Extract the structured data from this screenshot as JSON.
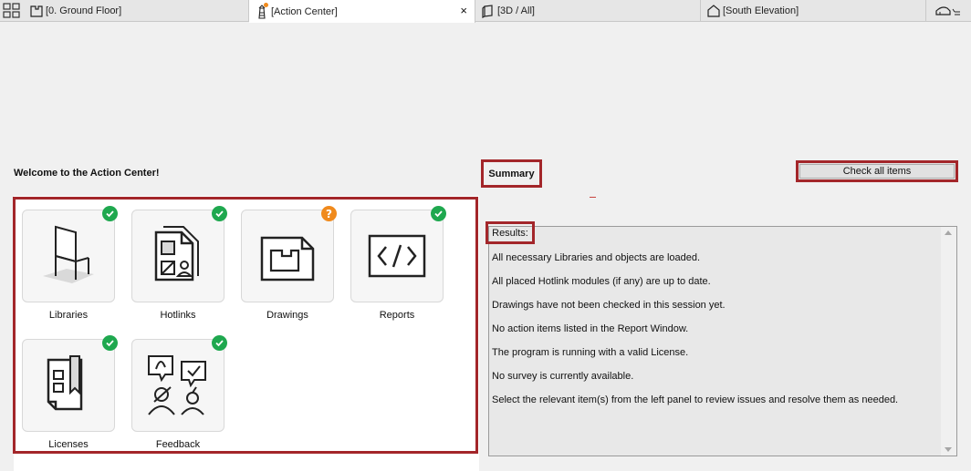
{
  "tabs": [
    {
      "label": "[0. Ground Floor]",
      "icon": "floor-plan-icon"
    },
    {
      "label": "[Action Center]",
      "icon": "lighthouse-icon",
      "active": true,
      "close": "×"
    },
    {
      "label": "[3D / All]",
      "icon": "cube-icon"
    },
    {
      "label": "[South Elevation]",
      "icon": "elevation-icon"
    }
  ],
  "welcome": "Welcome to the Action Center!",
  "tiles": [
    {
      "label": "Libraries",
      "status": "ok"
    },
    {
      "label": "Hotlinks",
      "status": "ok"
    },
    {
      "label": "Drawings",
      "status": "warn",
      "badge_text": "?"
    },
    {
      "label": "Reports",
      "status": "ok"
    },
    {
      "label": "Licenses",
      "status": "ok"
    },
    {
      "label": "Feedback",
      "status": "ok"
    }
  ],
  "summary": {
    "title": "Summary",
    "check_all_label": "Check all items",
    "results_title": "Results:",
    "lines": [
      "All necessary Libraries and objects are loaded.",
      "All placed Hotlink modules (if any) are up to date.",
      "Drawings have not been checked in this session yet.",
      "No action items listed in the Report Window.",
      "The program is running with a valid License.",
      "No survey is currently available.",
      "Select the relevant item(s) from the left panel to review issues and resolve them as needed."
    ]
  },
  "colors": {
    "highlight": "#a3262a",
    "ok_badge": "#1fa84f",
    "warn_badge": "#f08a1c"
  }
}
